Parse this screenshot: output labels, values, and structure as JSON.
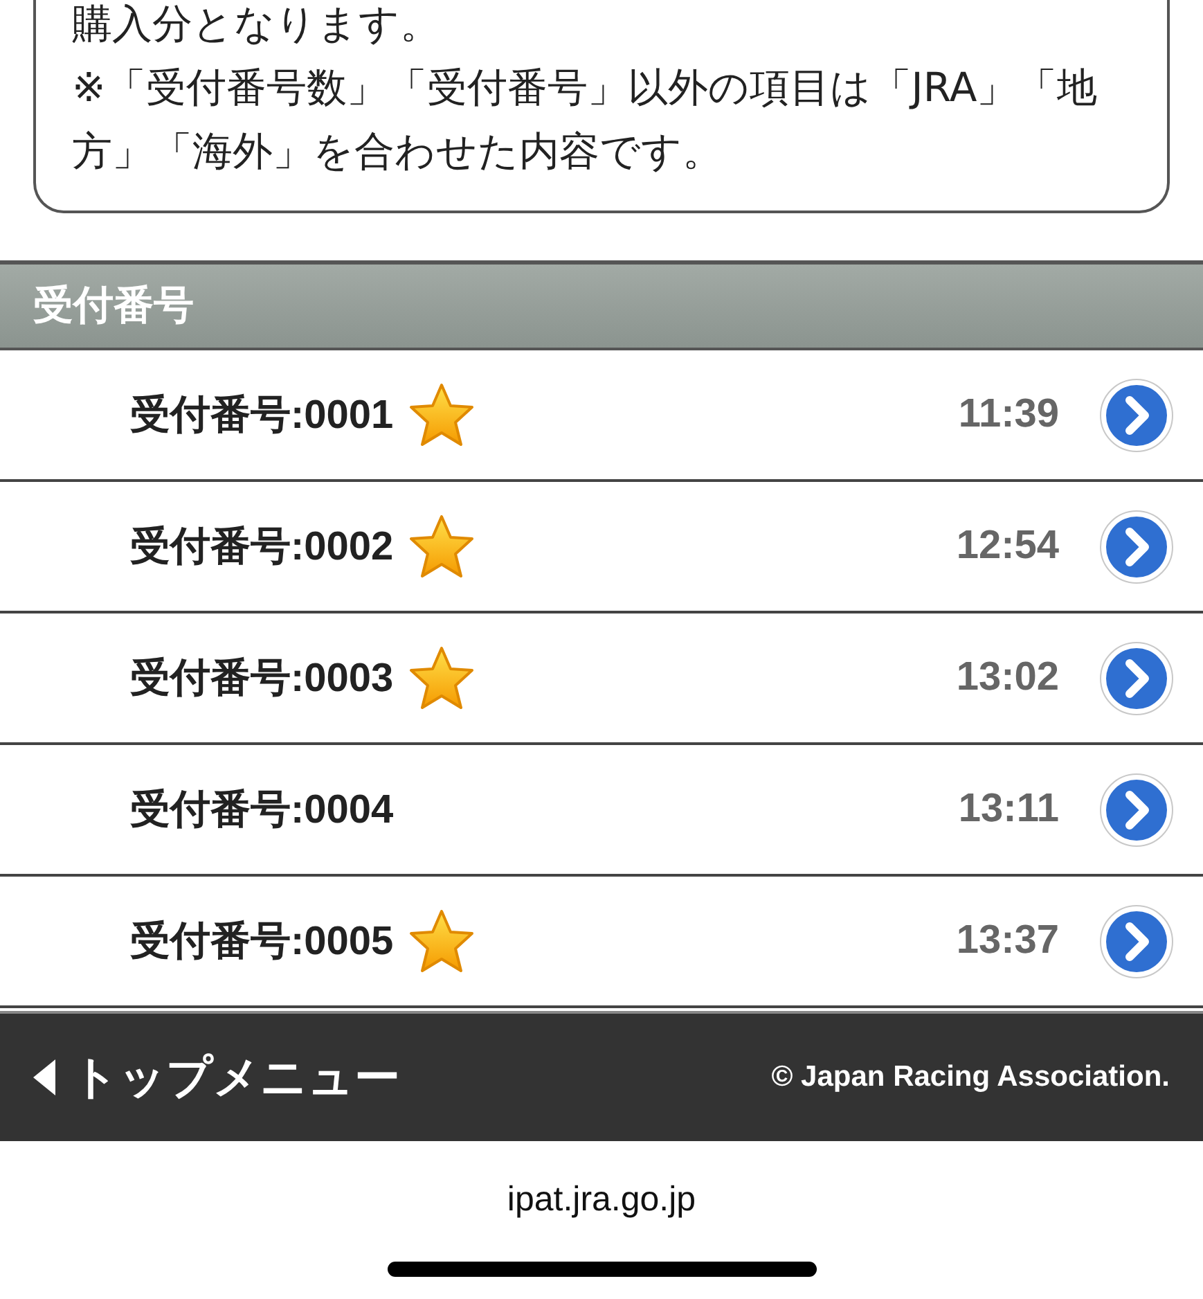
{
  "notes": [
    "購入分となります。",
    "※「受付番号数」「受付番号」以外の項目は「JRA」「地方」「海外」を合わせた内容です。"
  ],
  "section_header": "受付番号",
  "receipts": [
    {
      "label": "受付番号:0001",
      "starred": true,
      "time": "11:39"
    },
    {
      "label": "受付番号:0002",
      "starred": true,
      "time": "12:54"
    },
    {
      "label": "受付番号:0003",
      "starred": true,
      "time": "13:02"
    },
    {
      "label": "受付番号:0004",
      "starred": false,
      "time": "13:11"
    },
    {
      "label": "受付番号:0005",
      "starred": true,
      "time": "13:37"
    }
  ],
  "footer": {
    "back_link": "トップメニュー",
    "copyright": "© Japan Racing Association."
  },
  "browser": {
    "url": "ipat.jra.go.jp"
  }
}
